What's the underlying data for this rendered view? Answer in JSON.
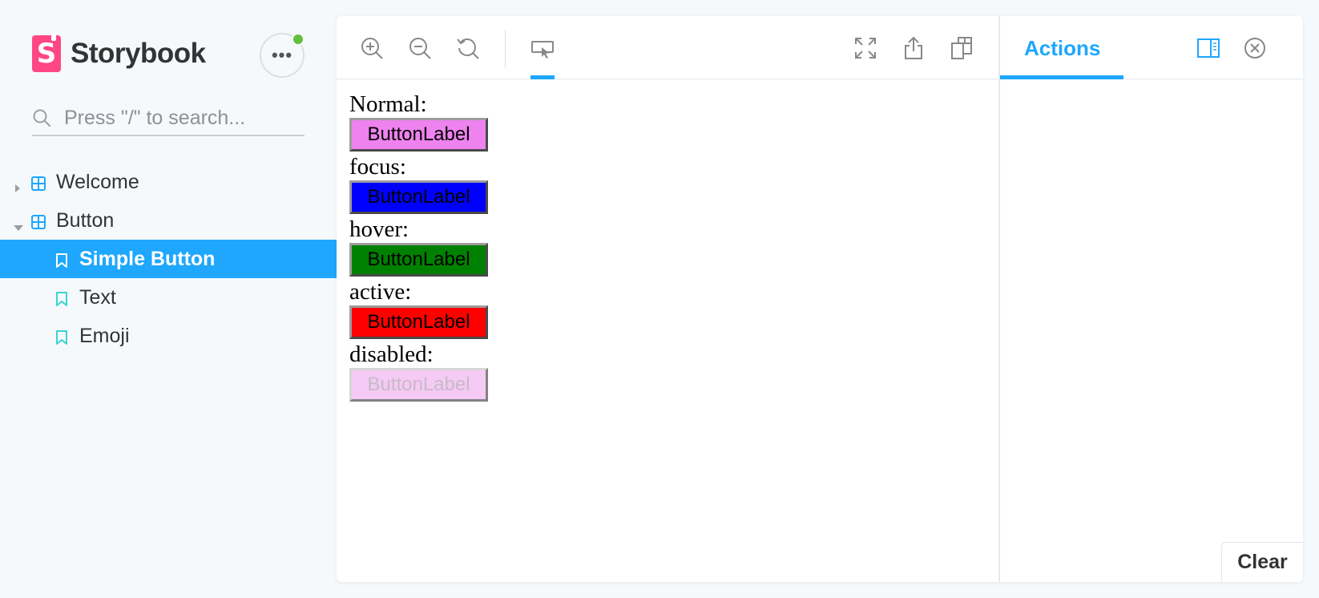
{
  "sidebar": {
    "brand": {
      "logo_letter": "S",
      "name": "Storybook"
    },
    "menu_label": "•••",
    "search": {
      "placeholder": "Press \"/\" to search..."
    },
    "tree": [
      {
        "kind": "component",
        "label": "Welcome",
        "expanded": false
      },
      {
        "kind": "component",
        "label": "Button",
        "expanded": true
      },
      {
        "kind": "story",
        "label": "Simple Button",
        "selected": true
      },
      {
        "kind": "story",
        "label": "Text",
        "selected": false
      },
      {
        "kind": "story",
        "label": "Emoji",
        "selected": false
      }
    ]
  },
  "toolbar": {
    "icons": [
      "zoom-in-icon",
      "zoom-out-icon",
      "reset-zoom-icon",
      "viewport-icon",
      "fullscreen-icon",
      "share-icon",
      "copy-link-icon"
    ]
  },
  "canvas": {
    "states": [
      {
        "label": "Normal:",
        "button": "ButtonLabel"
      },
      {
        "label": "focus:",
        "button": "ButtonLabel"
      },
      {
        "label": "hover:",
        "button": "ButtonLabel"
      },
      {
        "label": "active:",
        "button": "ButtonLabel"
      },
      {
        "label": "disabled:",
        "button": "ButtonLabel"
      }
    ]
  },
  "addons": {
    "tab_label": "Actions",
    "clear_label": "Clear"
  },
  "colors": {
    "accent": "#1ea7fd",
    "brand": "#ff4785",
    "status_dot": "#66bf3c",
    "story_icon": "#37d5d3",
    "btn_normal": "#ee82ee",
    "btn_focus": "#0000ff",
    "btn_hover": "#008000",
    "btn_active": "#ff0000",
    "btn_disabled": "#f5caf5"
  }
}
